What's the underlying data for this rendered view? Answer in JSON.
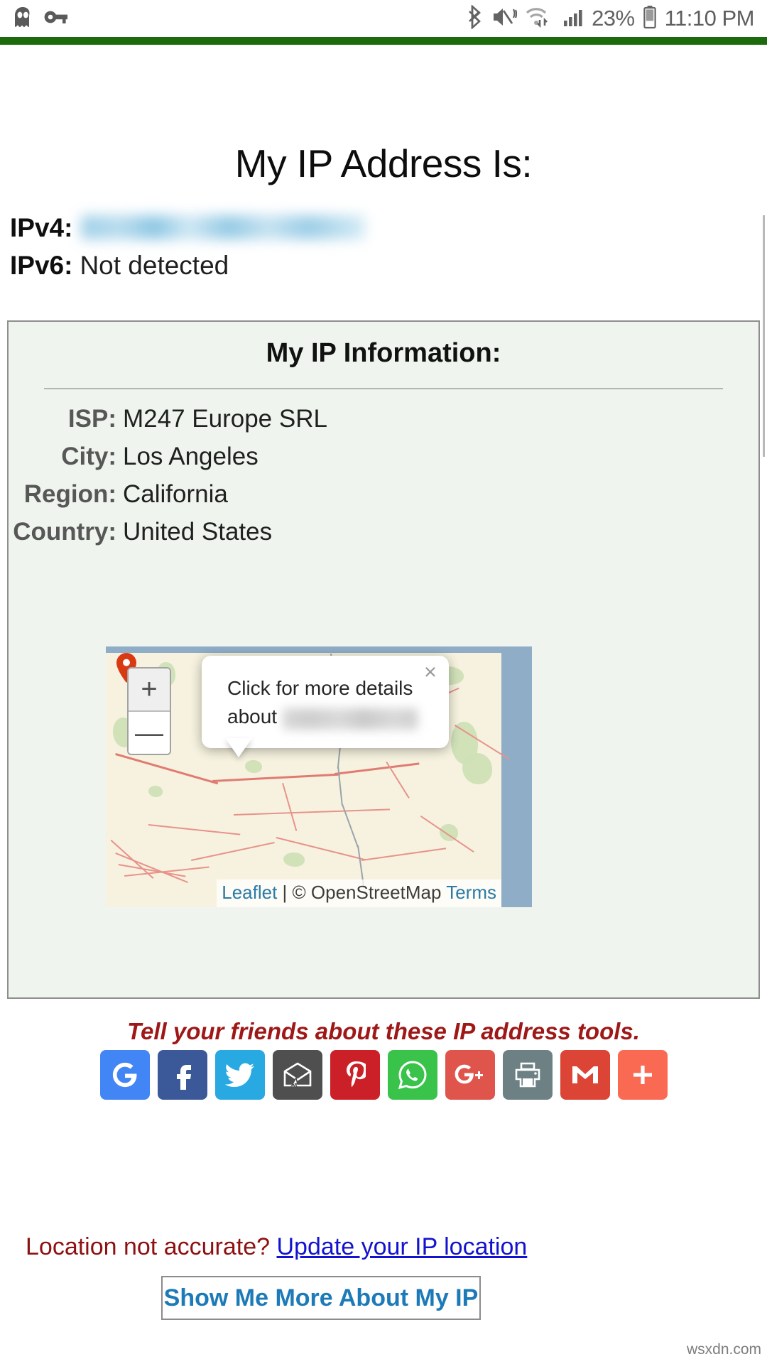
{
  "statusbar": {
    "left_icons": [
      "cyberghost-vpn-icon",
      "vpn-key-icon"
    ],
    "right_icons": [
      "bluetooth-icon",
      "sound-mute-vibrate-icon",
      "wifi-transfer-icon",
      "cell-signal-icon",
      "battery-icon"
    ],
    "battery_percent": "23%",
    "clock": "11:10 PM"
  },
  "page": {
    "heading": "My IP Address Is:",
    "ipv4_label": "IPv4:",
    "ipv4_value_redacted": true,
    "ipv6_label": "IPv6:",
    "ipv6_value": "Not detected"
  },
  "card": {
    "title": "My IP Information:",
    "rows": [
      {
        "label": "ISP:",
        "value": "M247 Europe SRL"
      },
      {
        "label": "City:",
        "value": "Los Angeles"
      },
      {
        "label": "Region:",
        "value": "California"
      },
      {
        "label": "Country:",
        "value": "United States"
      }
    ]
  },
  "map": {
    "zoom_in_label": "+",
    "zoom_out_label": "—",
    "marker_icon": "map-pin-icon",
    "popup": {
      "line1": "Click for more details",
      "line2_prefix": "about",
      "line2_value_redacted": true,
      "close_label": "×"
    },
    "attribution": {
      "leaflet": "Leaflet",
      "separator": " | ",
      "copyright": "© OpenStreetMap",
      "terms": "Terms"
    }
  },
  "below_map": {
    "not_accurate_text": "Location not accurate?",
    "update_link": "Update your IP location",
    "show_more_button": "Show Me More About My IP",
    "tell_friends": "Tell your friends about these IP address tools."
  },
  "share_buttons": [
    {
      "name": "google-search-share",
      "icon": "google-g-icon",
      "color": "#4285f4"
    },
    {
      "name": "facebook-share",
      "icon": "facebook-f-icon",
      "color": "#3b5998"
    },
    {
      "name": "twitter-share",
      "icon": "twitter-bird-icon",
      "color": "#29a9e1"
    },
    {
      "name": "email-share",
      "icon": "envelope-cursor-icon",
      "color": "#4f4f4f"
    },
    {
      "name": "pinterest-share",
      "icon": "pinterest-p-icon",
      "color": "#cb2027"
    },
    {
      "name": "whatsapp-share",
      "icon": "whatsapp-icon",
      "color": "#3ac34a"
    },
    {
      "name": "googleplus-share",
      "icon": "google-plus-icon",
      "color": "#e0554b"
    },
    {
      "name": "print-share",
      "icon": "printer-icon",
      "color": "#6d8184"
    },
    {
      "name": "gmail-share",
      "icon": "gmail-m-icon",
      "color": "#dc4436"
    },
    {
      "name": "more-share",
      "icon": "plus-icon",
      "color": "#fa6a52"
    }
  ],
  "watermark": "wsxdn.com",
  "colors": {
    "green_bar": "#1d6a0c",
    "card_bg": "#eff5ee",
    "card_border": "#8e8e8e",
    "link_blue": "#1313cf",
    "accent_blue": "#1d7ab8",
    "alert_red": "#8e1111"
  }
}
